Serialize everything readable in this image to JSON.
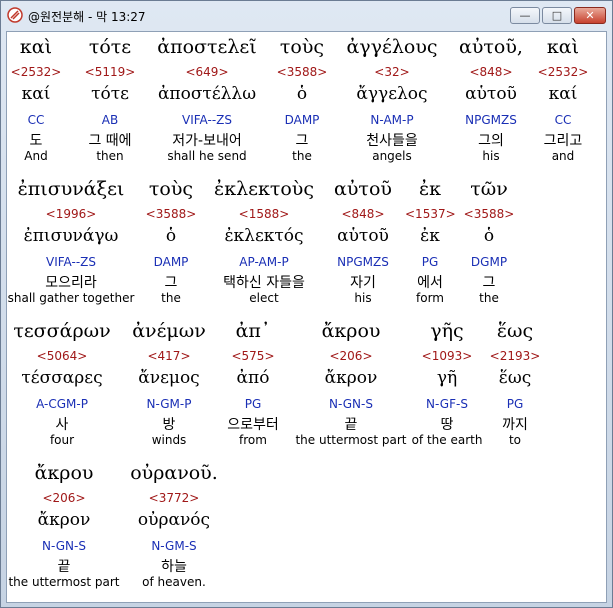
{
  "window": {
    "title": "@원전분해 - 막 13:27",
    "min_symbol": "—",
    "max_symbol": "□",
    "close_symbol": "✕"
  },
  "rows": [
    {
      "words": [
        {
          "greek": "καὶ",
          "num": "<2532>",
          "lex": "καί",
          "parse": "CC",
          "kor": "도",
          "eng": "And"
        },
        {
          "greek": "τότε",
          "num": "<5119>",
          "lex": "τότε",
          "parse": "AB",
          "kor": "그 때에",
          "eng": "then"
        },
        {
          "greek": "ἀποστελεῖ",
          "num": "<649>",
          "lex": "ἀποστέλλω",
          "parse": "VIFA--ZS",
          "kor": "저가-보내어",
          "eng": "shall he send"
        },
        {
          "greek": "τοὺς",
          "num": "<3588>",
          "lex": "ὁ",
          "parse": "DAMP",
          "kor": "그",
          "eng": "the"
        },
        {
          "greek": "ἀγγέλους",
          "num": "<32>",
          "lex": "ἄγγελος",
          "parse": "N-AM-P",
          "kor": "천사들을",
          "eng": "angels"
        },
        {
          "greek": "αὐτοῦ,",
          "num": "<848>",
          "lex": "αὑτοῦ",
          "parse": "NPGMZS",
          "kor": "그의",
          "eng": "his"
        },
        {
          "greek": "καὶ",
          "num": "<2532>",
          "lex": "καί",
          "parse": "CC",
          "kor": "그리고",
          "eng": "and"
        }
      ]
    },
    {
      "words": [
        {
          "greek": "ἐπισυνάξει",
          "num": "<1996>",
          "lex": "ἐπισυνάγω",
          "parse": "VIFA--ZS",
          "kor": "모으리라",
          "eng": "shall gather together"
        },
        {
          "greek": "τοὺς",
          "num": "<3588>",
          "lex": "ὁ",
          "parse": "DAMP",
          "kor": "그",
          "eng": "the"
        },
        {
          "greek": "ἐκλεκτοὺς",
          "num": "<1588>",
          "lex": "ἐκλεκτός",
          "parse": "AP-AM-P",
          "kor": "택하신 자들을",
          "eng": "elect"
        },
        {
          "greek": "αὐτοῦ",
          "num": "<848>",
          "lex": "αὑτοῦ",
          "parse": "NPGMZS",
          "kor": "자기",
          "eng": "his"
        },
        {
          "greek": "ἐκ",
          "num": "<1537>",
          "lex": "ἐκ",
          "parse": "PG",
          "kor": "에서",
          "eng": "form"
        },
        {
          "greek": "τῶν",
          "num": "<3588>",
          "lex": "ὁ",
          "parse": "DGMP",
          "kor": "그",
          "eng": "the"
        }
      ]
    },
    {
      "words": [
        {
          "greek": "τεσσάρων",
          "num": "<5064>",
          "lex": "τέσσαρες",
          "parse": "A-CGM-P",
          "kor": "사",
          "eng": "four"
        },
        {
          "greek": "ἀνέμων",
          "num": "<417>",
          "lex": "ἄνεμος",
          "parse": "N-GM-P",
          "kor": "방",
          "eng": "winds"
        },
        {
          "greek": "ἀπ᾽",
          "num": "<575>",
          "lex": "ἀπό",
          "parse": "PG",
          "kor": "으로부터",
          "eng": "from"
        },
        {
          "greek": "ἄκρου",
          "num": "<206>",
          "lex": "ἄκρον",
          "parse": "N-GN-S",
          "kor": "끝",
          "eng": "the uttermost part"
        },
        {
          "greek": "γῆς",
          "num": "<1093>",
          "lex": "γῆ",
          "parse": "N-GF-S",
          "kor": "땅",
          "eng": "of the earth"
        },
        {
          "greek": "ἕως",
          "num": "<2193>",
          "lex": "ἕως",
          "parse": "PG",
          "kor": "까지",
          "eng": "to"
        }
      ]
    },
    {
      "words": [
        {
          "greek": "ἄκρου",
          "num": "<206>",
          "lex": "ἄκρον",
          "parse": "N-GN-S",
          "kor": "끝",
          "eng": "the uttermost part"
        },
        {
          "greek": "οὐρανοῦ.",
          "num": "<3772>",
          "lex": "οὐρανός",
          "parse": "N-GM-S",
          "kor": "하늘",
          "eng": "of heaven."
        }
      ]
    }
  ]
}
